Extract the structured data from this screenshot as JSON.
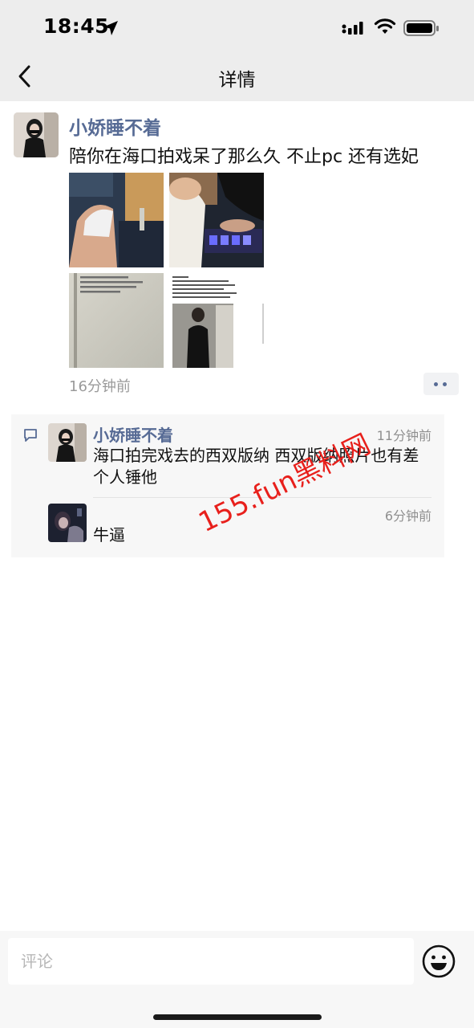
{
  "status_bar": {
    "time": "18:45"
  },
  "nav": {
    "title": "详情"
  },
  "post": {
    "author": "小娇睡不着",
    "text": "陪你在海口拍戏呆了那么久 不止pc 还有选妃",
    "time_ago": "16分钟前",
    "photo_count": 4
  },
  "comments": [
    {
      "author": "小娇睡不着",
      "time": "11分钟前",
      "text": "海口拍完戏去的西双版纳 西双版纳照片也有差个人锤他"
    },
    {
      "author": "",
      "time": "6分钟前",
      "text": "牛逼"
    }
  ],
  "watermark": "155.fun黑料网",
  "comment_bar": {
    "placeholder": "评论"
  },
  "colors": {
    "name_link": "#576b95",
    "watermark": "#e8201c",
    "header_bg": "#ededed"
  },
  "icons": [
    "location-arrow-icon",
    "signal-icon",
    "wifi-icon",
    "battery-icon",
    "back-icon",
    "comment-icon",
    "emoji-icon",
    "more-icon"
  ]
}
